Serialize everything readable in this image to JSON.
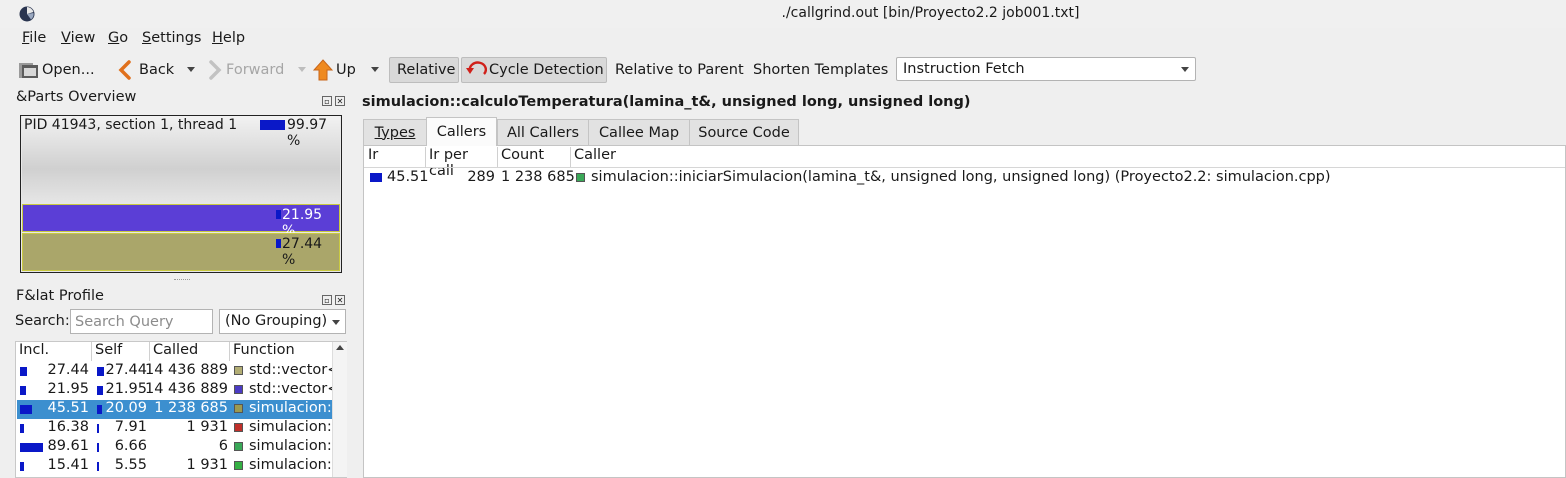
{
  "window": {
    "title": "./callgrind.out [bin/Proyecto2.2 job001.txt]"
  },
  "menu": [
    {
      "label": "File",
      "mnemonic": "F",
      "rest": "ile"
    },
    {
      "label": "View",
      "mnemonic": "V",
      "rest": "iew"
    },
    {
      "label": "Go",
      "mnemonic": "G",
      "rest": "o"
    },
    {
      "label": "Settings",
      "mnemonic": "S",
      "rest": "ettings"
    },
    {
      "label": "Help",
      "mnemonic": "H",
      "rest": "elp"
    }
  ],
  "toolbar": {
    "open": "Open...",
    "back": "Back",
    "forward": "Forward",
    "up": "Up",
    "relative": "Relative",
    "cycle_detection": "Cycle Detection",
    "relative_to_parent": "Relative to Parent",
    "shorten_templates": "Shorten Templates",
    "event_type": "Instruction Fetch"
  },
  "parts_overview": {
    "title": "&Parts Overview",
    "part_label": "PID 41943, section 1, thread 1",
    "part_percent": "99.97 %",
    "segments": [
      {
        "percent": "21.95 %",
        "color": "#5b3ed6"
      },
      {
        "percent": "27.44 %",
        "color": "#aaa66a"
      }
    ]
  },
  "flat_profile": {
    "title": "F&lat Profile",
    "search_label": "Search:",
    "search_placeholder": "Search Query",
    "grouping": "(No Grouping)",
    "columns": [
      "Incl.",
      "Self",
      "Called",
      "Function"
    ],
    "rows": [
      {
        "incl": "27.44",
        "self": "27.44",
        "called": "14 436 889",
        "func": "std::vector<s",
        "color": "#b2ad74",
        "incl_frac": 0.27,
        "self_frac": 0.27,
        "selected": false
      },
      {
        "incl": "21.95",
        "self": "21.95",
        "called": "14 436 889",
        "func": "std::vector<c",
        "color": "#4b3bc4",
        "incl_frac": 0.22,
        "self_frac": 0.22,
        "selected": false
      },
      {
        "incl": "45.51",
        "self": "20.09",
        "called": "1 238 685",
        "func": "simulacion::c",
        "color": "#9c9a50",
        "incl_frac": 0.46,
        "self_frac": 0.2,
        "selected": true
      },
      {
        "incl": "16.38",
        "self": "7.91",
        "called": "1 931",
        "func": "simulacion::v",
        "color": "#c0302a",
        "incl_frac": 0.16,
        "self_frac": 0.08,
        "selected": false
      },
      {
        "incl": "89.61",
        "self": "6.66",
        "called": "6",
        "func": "simulacion::i",
        "color": "#3aa858",
        "incl_frac": 0.9,
        "self_frac": 0.07,
        "selected": false
      },
      {
        "incl": "15.41",
        "self": "5.55",
        "called": "1 931",
        "func": "simulacion::c",
        "color": "#35b044",
        "incl_frac": 0.15,
        "self_frac": 0.06,
        "selected": false
      }
    ]
  },
  "detail": {
    "heading": "simulacion::calculoTemperatura(lamina_t&, unsigned long, unsigned long)",
    "tabs": [
      {
        "label": "Types",
        "active": false
      },
      {
        "label": "Callers",
        "active": true
      },
      {
        "label": "All Callers",
        "active": false
      },
      {
        "label": "Callee Map",
        "active": false
      },
      {
        "label": "Source Code",
        "active": false
      }
    ],
    "columns": [
      "Ir",
      "Ir per call",
      "Count",
      "Caller"
    ],
    "rows": [
      {
        "ir": "45.51",
        "ir_per_call": "289",
        "count": "1 238 685",
        "caller": "simulacion::iniciarSimulacion(lamina_t&, unsigned long, unsigned long) (Proyecto2.2: simulacion.cpp)",
        "color": "#3aa858",
        "ir_frac": 0.46
      }
    ]
  }
}
